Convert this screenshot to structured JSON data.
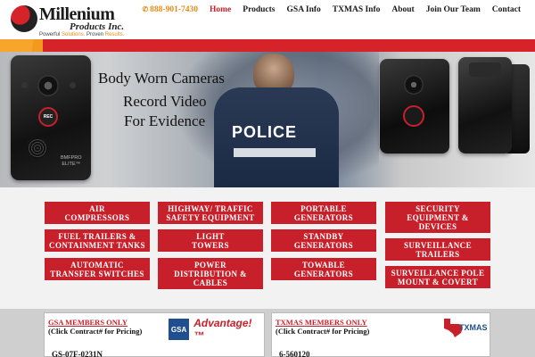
{
  "header": {
    "logo_name": "Millenium",
    "logo_sub": "Products Inc.",
    "tagline_a": "Powerful ",
    "tagline_b": "Solutions.",
    "tagline_c": " Proven ",
    "tagline_d": "Results.",
    "phone": "888-901-7430",
    "nav": [
      "Home",
      "Products",
      "GSA Info",
      "TXMAS Info",
      "About",
      "Join Our Team",
      "Contact"
    ]
  },
  "hero": {
    "line1": "Body Worn Cameras",
    "line2": "Record Video",
    "line3": "For Evidence",
    "camera_button": "REC",
    "camera_brand_1": "BMFPRO",
    "camera_brand_2": "ELITE™",
    "vest_label": "POLICE"
  },
  "products": [
    "AIR\nCOMPRESSORS",
    "HIGHWAY/ TRAFFIC\nSAFETY EQUIPMENT",
    "PORTABLE\nGENERATORS",
    "SECURITY\nEQUIPMENT &\nDEVICES",
    "FUEL TRAILERS &\nCONTAINMENT TANKS",
    "LIGHT\nTOWERS",
    "STANDBY\nGENERATORS",
    "SURVEILLANCE\nTRAILERS",
    "AUTOMATIC\nTRANSFER SWITCHES",
    "POWER\nDISTRIBUTION &\nCABLES",
    "TOWABLE\nGENERATORS",
    "SURVEILLANCE POLE\nMOUNT & COVERT"
  ],
  "gsa": {
    "title": "GSA MEMBERS ONLY",
    "click": "(Click Contract# for Pricing)",
    "logo_box": "GSA",
    "logo_text": "Advantage!™",
    "contract": "GS-07F-0231N"
  },
  "txmas": {
    "title": "TXMAS MEMBERS ONLY",
    "click": "(Click Contract# for Pricing)",
    "logo_text": "TXMAS",
    "contract": "6-560120"
  },
  "colors": {
    "brand_red": "#c8202a",
    "accent_orange": "#f29a1e"
  }
}
